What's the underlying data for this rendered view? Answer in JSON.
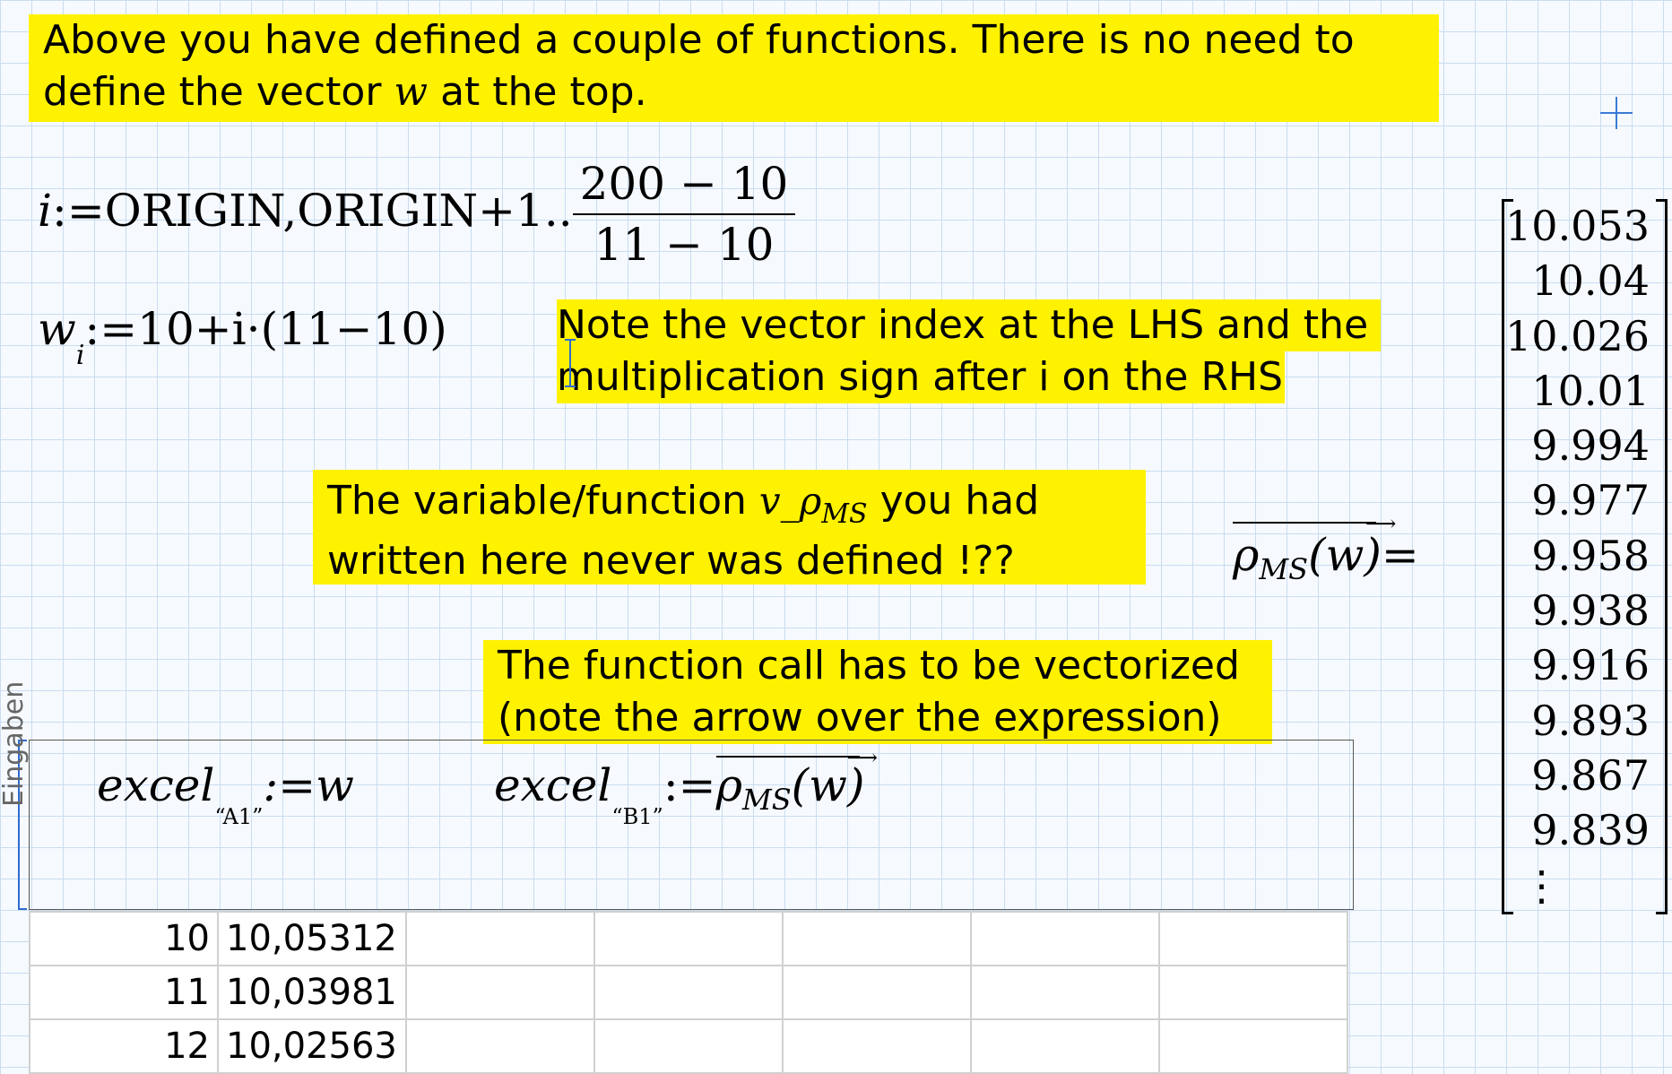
{
  "notes": {
    "top": {
      "line1": "Above you have defined a couple of functions. There is no need to",
      "line2_pre": "define the vector ",
      "line2_var": "w",
      "line2_post": " at the top."
    },
    "index": {
      "line1": "Note the vector index at the LHS and the",
      "line2": "multiplication sign after i on the RHS"
    },
    "undefined": {
      "line1_pre": "The variable/function ",
      "line1_var": "v_ρ",
      "line1_sub": "MS",
      "line1_post": " you had",
      "line2": "written here never was defined !??"
    },
    "vectorize": {
      "line1": "The function call has to be vectorized",
      "line2": "(note the arrow over the expression)"
    }
  },
  "equations": {
    "range_def": {
      "lhs": "i",
      "assign": ":=",
      "start": "ORIGIN,ORIGIN+1..",
      "num": "200 − 10",
      "den": "11 − 10"
    },
    "w_def": {
      "lhs": "w",
      "index": "i",
      "rhs": ":=10+i·(11−10)"
    },
    "result_lhs": {
      "rho": "ρ",
      "sub": "MS",
      "arg": "(w)",
      "eq": "="
    },
    "excel_a": {
      "name": "excel",
      "sub": "“A1”",
      "rhs": ":=w"
    },
    "excel_b": {
      "name": "excel",
      "sub": "“B1”",
      "rhs_pre": ":=",
      "rho": "ρ",
      "rho_sub": "MS",
      "arg": "(w)"
    }
  },
  "result_vector": [
    "10.053",
    "10.04",
    "10.026",
    "10.01",
    "9.994",
    "9.977",
    "9.958",
    "9.938",
    "9.916",
    "9.893",
    "9.867",
    "9.839",
    "⋮"
  ],
  "region_label": "Eingaben",
  "sheet": {
    "rows": [
      [
        "10",
        "10,05312",
        "",
        "",
        "",
        "",
        ""
      ],
      [
        "11",
        "10,03981",
        "",
        "",
        "",
        "",
        ""
      ],
      [
        "12",
        "10,02563",
        "",
        "",
        "",
        "",
        ""
      ]
    ]
  }
}
